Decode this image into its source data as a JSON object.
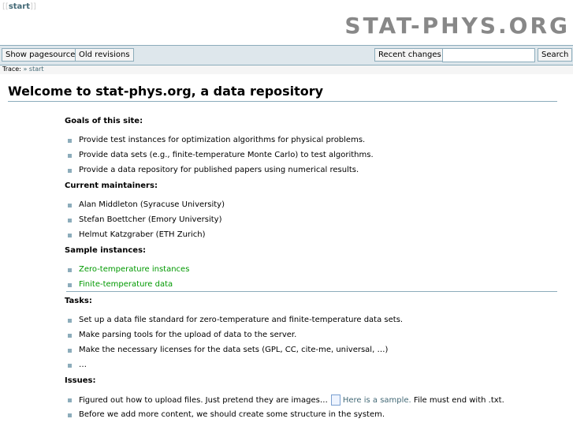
{
  "header": {
    "pagename_link": "start",
    "logo": "STAT-PHYS.ORG"
  },
  "toolbar": {
    "show_source": "Show pagesource",
    "old_revisions": "Old revisions",
    "recent_changes": "Recent changes",
    "search_value": "",
    "search_button": "Search"
  },
  "trace": {
    "label": "Trace:",
    "sep": "»",
    "link": "start"
  },
  "title": "Welcome to stat-phys.org, a data repository",
  "sections": {
    "goals": {
      "heading": "Goals of this site:",
      "items": [
        "Provide test instances for optimization algorithms for physical problems.",
        "Provide data sets (e.g., finite-temperature Monte Carlo) to test algorithms.",
        "Provide a data repository for published papers using numerical results."
      ]
    },
    "maintainers": {
      "heading": "Current maintainers:",
      "items": [
        "Alan Middleton (Syracuse University)",
        "Stefan Boettcher (Emory University)",
        "Helmut Katzgraber (ETH Zurich)"
      ]
    },
    "samples": {
      "heading": "Sample instances:",
      "items": [
        "Zero-temperature instances",
        "Finite-temperature data"
      ]
    },
    "tasks": {
      "heading": "Tasks:",
      "items": [
        "Set up a data file standard for zero-temperature and finite-temperature data sets.",
        "Make parsing tools for the upload of data to the server.",
        "Make the necessary licenses for the data sets (GPL, CC, cite-me, universal, …)",
        "…"
      ]
    },
    "issues": {
      "heading": "Issues:",
      "item1_pre": "Figured out how to upload files. Just pretend they are images…",
      "item1_link": "Here is a sample.",
      "item1_post": "File must end with .txt.",
      "item2": "Before we add more content, we should create some structure in the system."
    }
  }
}
